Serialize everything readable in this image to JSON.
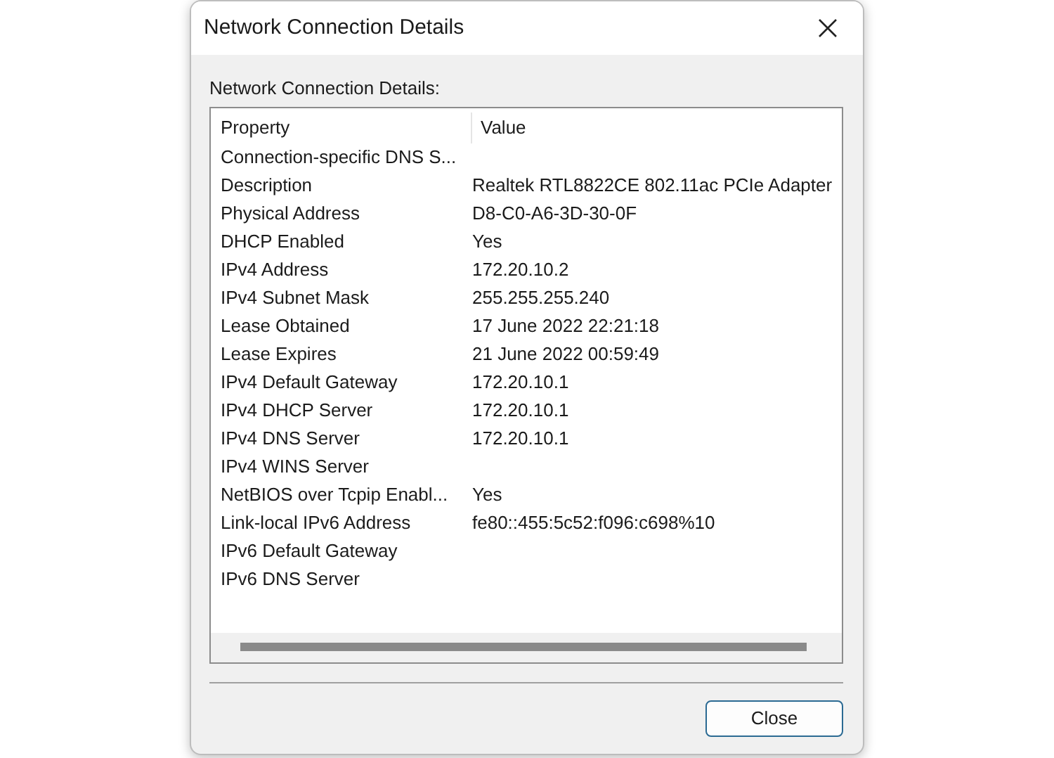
{
  "window": {
    "title": "Network Connection Details"
  },
  "group_label": "Network Connection Details:",
  "table": {
    "columns": [
      "Property",
      "Value"
    ],
    "rows": [
      {
        "property": "Connection-specific DNS S..."
      },
      {
        "property": "Description",
        "value": "Realtek RTL8822CE 802.11ac PCIe Adapter"
      },
      {
        "property": "Physical Address",
        "value": "D8-C0-A6-3D-30-0F"
      },
      {
        "property": "DHCP Enabled",
        "value": "Yes"
      },
      {
        "property": "IPv4 Address",
        "value": "172.20.10.2"
      },
      {
        "property": "IPv4 Subnet Mask",
        "value": "255.255.255.240"
      },
      {
        "property": "Lease Obtained",
        "value": "17 June 2022 22:21:18"
      },
      {
        "property": "Lease Expires",
        "value": "21 June 2022 00:59:49"
      },
      {
        "property": "IPv4 Default Gateway",
        "value": "172.20.10.1"
      },
      {
        "property": "IPv4 DHCP Server",
        "value": "172.20.10.1"
      },
      {
        "property": "IPv4 DNS Server",
        "value": "172.20.10.1"
      },
      {
        "property": "IPv4 WINS Server"
      },
      {
        "property": "NetBIOS over Tcpip Enabl...",
        "value": "Yes"
      },
      {
        "property": "Link-local IPv6 Address",
        "value": "fe80::455:5c52:f096:c698%10"
      },
      {
        "property": "IPv6 Default Gateway"
      },
      {
        "property": "IPv6 DNS Server"
      }
    ]
  },
  "buttons": [
    "Close"
  ]
}
